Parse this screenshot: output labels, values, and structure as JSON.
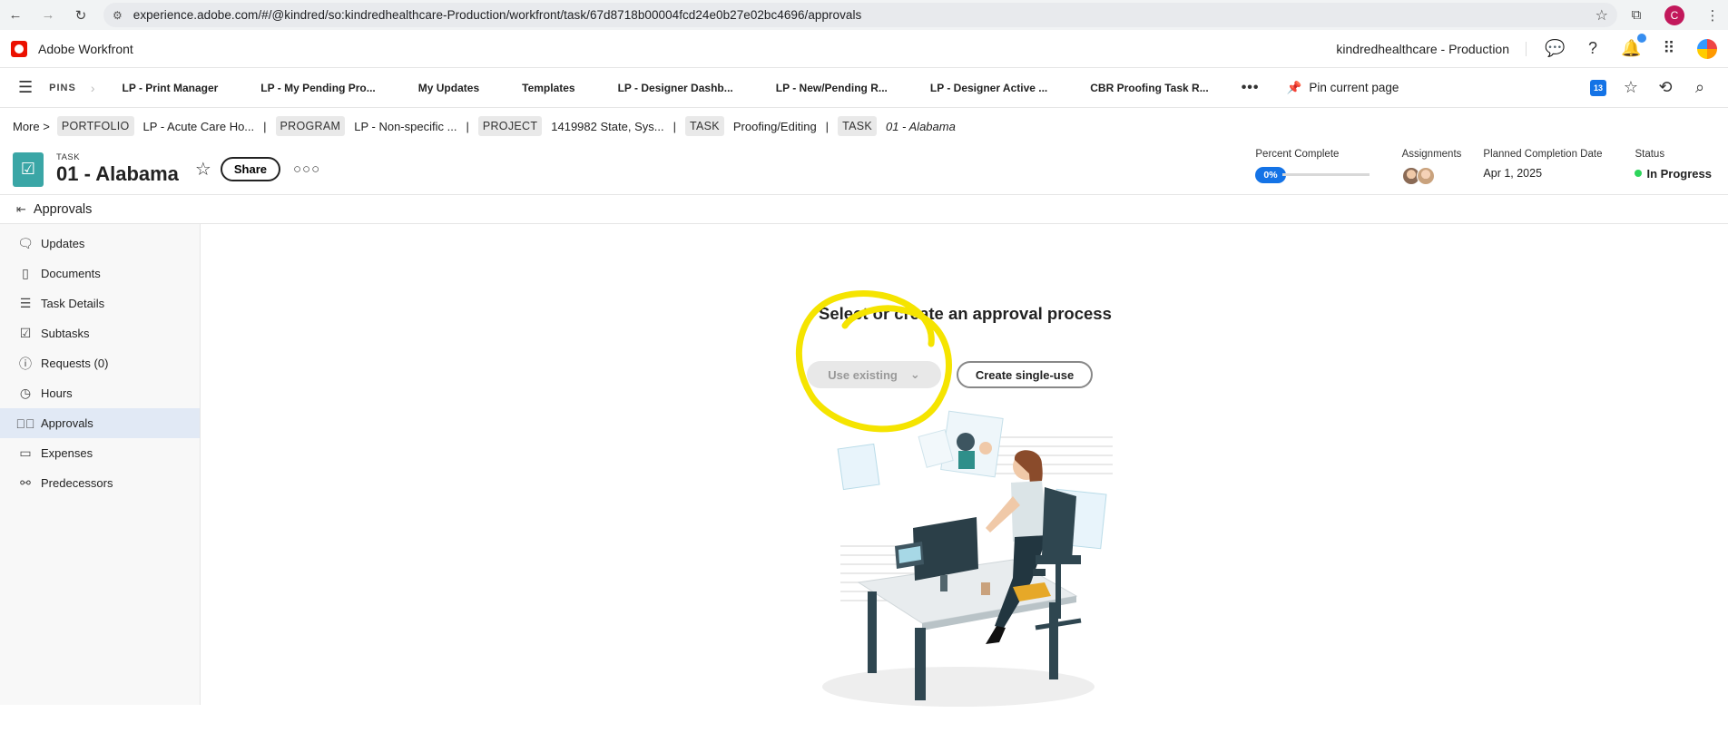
{
  "browser": {
    "url": "experience.adobe.com/#/@kindred/so:kindredhealthcare-Production/workfront/task/67d8718b00004fcd24e0b27e02bc4696/approvals",
    "profile_initial": "C"
  },
  "app": {
    "name": "Adobe Workfront",
    "environment": "kindredhealthcare - Production"
  },
  "pins": {
    "label": "PINS",
    "items": [
      "LP - Print Manager",
      "LP - My Pending Pro...",
      "My Updates",
      "Templates",
      "LP - Designer Dashb...",
      "LP - New/Pending R...",
      "LP - Designer Active ...",
      "CBR Proofing Task R..."
    ],
    "more": "•••",
    "pin_current": "Pin current page",
    "calendar_badge": "13"
  },
  "breadcrumb": {
    "more": "More",
    "parts": [
      {
        "tag": "PORTFOLIO",
        "text": "LP - Acute Care Ho..."
      },
      {
        "tag": "PROGRAM",
        "text": "LP - Non-specific ..."
      },
      {
        "tag": "PROJECT",
        "text": "1419982 State, Sys..."
      },
      {
        "tag": "TASK",
        "text": "Proofing/Editing"
      },
      {
        "tag": "TASK",
        "text": "01 - Alabama"
      }
    ]
  },
  "task": {
    "kind": "TASK",
    "title": "01 - Alabama",
    "share_label": "Share",
    "percent_label": "Percent Complete",
    "percent_value": "0%",
    "assignments_label": "Assignments",
    "planned_label": "Planned Completion Date",
    "planned_value": "Apr 1, 2025",
    "status_label": "Status",
    "status_value": "In Progress",
    "status_color": "#2dd55b"
  },
  "section": {
    "title": "Approvals"
  },
  "sidebar": {
    "items": [
      {
        "label": "Updates",
        "icon": "comment-icon"
      },
      {
        "label": "Documents",
        "icon": "document-icon"
      },
      {
        "label": "Task Details",
        "icon": "details-icon"
      },
      {
        "label": "Subtasks",
        "icon": "checklist-icon"
      },
      {
        "label": "Requests (0)",
        "icon": "request-icon"
      },
      {
        "label": "Hours",
        "icon": "clock-icon"
      },
      {
        "label": "Approvals",
        "icon": "check-circle-icon"
      },
      {
        "label": "Expenses",
        "icon": "money-icon"
      },
      {
        "label": "Predecessors",
        "icon": "predecessor-icon"
      }
    ]
  },
  "approvals": {
    "title": "Select or create an approval process",
    "use_existing": "Use existing",
    "create_single": "Create single-use"
  },
  "colors": {
    "accent": "#1473e6",
    "task_icon": "#3aa6a6",
    "highlight": "#f5e400"
  }
}
